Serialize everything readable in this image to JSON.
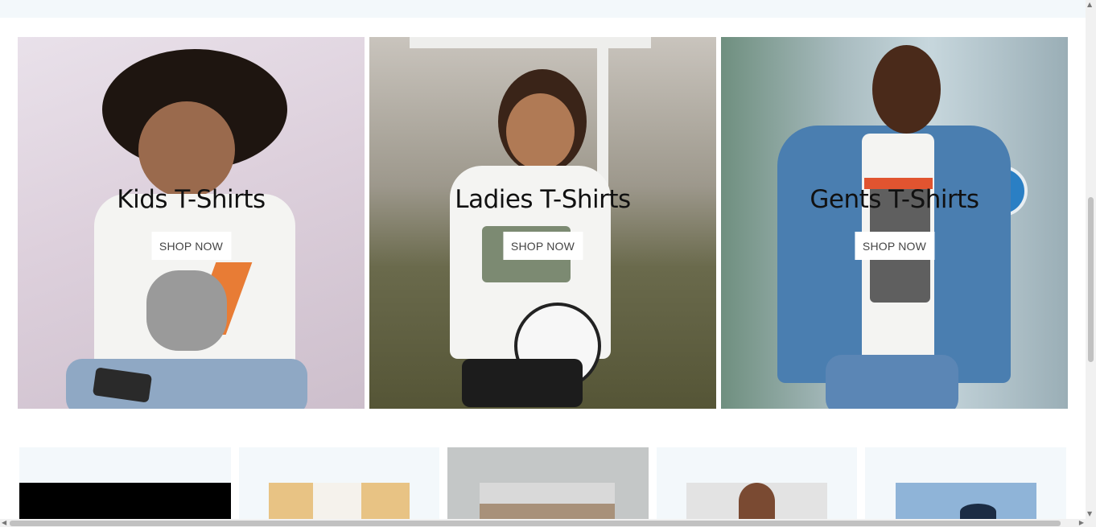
{
  "promos": [
    {
      "title": "Kids T-Shirts",
      "button": "SHOP NOW"
    },
    {
      "title": "Ladies T-Shirts",
      "button": "SHOP NOW"
    },
    {
      "title": "Gents T-Shirts",
      "button": "SHOP NOW"
    }
  ],
  "scrollbars": {
    "up_arrow": "▲",
    "down_arrow": "▼",
    "left_arrow": "◀",
    "right_arrow": "▶"
  },
  "colors": {
    "page_background": "#ffffff",
    "section_tint": "#f3f8fb",
    "button_background": "#ffffff",
    "title_color": "#111111"
  }
}
